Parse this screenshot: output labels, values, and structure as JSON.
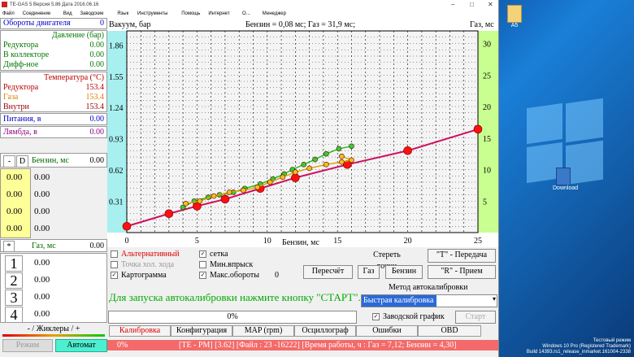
{
  "window": {
    "title": "TE-GAS 5 Версия 5.86  Дата 2016.06.16"
  },
  "menu": [
    "Файл",
    "Соединение",
    "Вид",
    "Заводские",
    "Язык",
    "Инструменты",
    "Помощь",
    "Интернет",
    "О...",
    "Менеджер"
  ],
  "left": {
    "rpm_label": "Обороты двигателя",
    "rpm_value": "0",
    "pressure_header": "Давление (бар)",
    "reducer_label": "Редуктора",
    "reducer_value": "0.00",
    "collector_label": "В коллекторе",
    "collector_value": "0.00",
    "diff_label": "Дифф-ное",
    "diff_value": "0.00",
    "temp_header": "Температура (°C)",
    "t_reducer_label": "Редуктора",
    "t_reducer_value": "153.4",
    "t_gas_label": "Газа",
    "t_gas_value": "153.4",
    "t_inside_label": "Внутри",
    "t_inside_value": "153.4",
    "supply_label": "Питания, в",
    "supply_value": "0.00",
    "lambda_label": "Лямбда, в",
    "lambda_value": "0.00",
    "minus": "-",
    "d": "D",
    "petrol_ms_label": "Бензин, мс",
    "petrol_ms_value": "0.00",
    "grid_values": [
      [
        "0.00",
        "0.00"
      ],
      [
        "0.00",
        "0.00"
      ],
      [
        "0.00",
        "0.00"
      ],
      [
        "0.00",
        "0.00"
      ]
    ],
    "star": "*",
    "gas_ms_label": "Газ, мс",
    "gas_ms_value": "0.00",
    "injectors": [
      {
        "n": "1",
        "v": "0.00"
      },
      {
        "n": "2",
        "v": "0.00"
      },
      {
        "n": "3",
        "v": "0.00"
      },
      {
        "n": "4",
        "v": "0.00"
      }
    ],
    "jiklers": "- / Жиклеры / +",
    "mode_off": "Режим",
    "mode_auto": "Автомат"
  },
  "chart_data": {
    "type": "scatter",
    "header_left": "Вакуум, бар",
    "header_mid": "Бензин = 0,08 мс; Газ = 31,9 мс;",
    "header_right": "Газ, мс",
    "xlabel": "Бензин, мс",
    "xticks": [
      "0",
      "5",
      "10",
      "15",
      "20",
      "25"
    ],
    "xlim": [
      0,
      25
    ],
    "yticks_left": [
      "0.31",
      "0.62",
      "0.93",
      "1.24",
      "1.55",
      "1.86"
    ],
    "ylim_left": [
      0,
      2.0
    ],
    "yticks_right": [
      "5",
      "10",
      "15",
      "20",
      "25",
      "30"
    ],
    "ylim_right": [
      0,
      32
    ],
    "grid": true,
    "series": [
      {
        "color": "#d01060",
        "marker": "#ff1010",
        "x": [
          0,
          3,
          5,
          7,
          9.5,
          12,
          15.7,
          20,
          25
        ],
        "y": [
          1.0,
          3.0,
          4.2,
          5.3,
          7.0,
          8.7,
          10.8,
          13.0,
          16.4
        ]
      },
      {
        "color": "#20c020",
        "marker": "#30d030",
        "x": [
          4,
          4.8,
          5.8,
          6.6,
          7.6,
          8.4,
          9.5,
          10.4,
          11.2,
          11.8,
          12.6,
          13.4,
          14.2,
          15.1,
          16
        ],
        "y": [
          4.0,
          5.0,
          5.6,
          6.0,
          6.4,
          7.0,
          7.7,
          8.5,
          9.3,
          10.0,
          10.8,
          11.6,
          12.5,
          13.3,
          13.7
        ]
      },
      {
        "color": "#e0a000",
        "marker": "#f0c020",
        "x": [
          4.2,
          5.2,
          6.2,
          7.3,
          8.3,
          9.3,
          10.2,
          11.1,
          12.0,
          13.0,
          14.2,
          15.3,
          16.0,
          15.3
        ],
        "y": [
          4.6,
          5.0,
          5.8,
          6.4,
          6.7,
          7.2,
          8.0,
          8.8,
          9.6,
          10.2,
          10.8,
          11.2,
          11.5,
          12.1
        ]
      }
    ]
  },
  "controls": {
    "alt": "Альтернативный",
    "grid": "сетка",
    "clear": "Стереть точки",
    "t_send": "\"T\" - Передача",
    "tochka": "Точка хол. хода",
    "minvpr": "Мин.впрыск",
    "kartogramma": "Картограмма",
    "maxrpm": "Макс.обороты",
    "maxrpm_val": "0",
    "recalc": "Пересчёт",
    "gas": "Газ",
    "petrol": "Бензин",
    "r_recv": "\"R\" - Прием",
    "method": "Метод автокалибровки",
    "start_msg": "Для запуска автокалибровки нажмите кнопку \"СТАРТ\".",
    "fast": "Быстрая калибровка",
    "progress": "0%",
    "factory": "Заводской график",
    "start": "Старт"
  },
  "tabs": [
    "Калибровка",
    "Конфигурация",
    "MAP (rpm)",
    "Осциллограф",
    "Ошибки",
    "OBD"
  ],
  "status": {
    "pct": "0%",
    "text": "[TE - PM] [3.62] [Файл : 23 -16222] [Время работы, ч : Газ = 7,12; Бензин = 4,30]"
  },
  "desktop": {
    "icon1": "A5",
    "icon2": "Download",
    "wm1": "Тестовый режим",
    "wm2": "Windows 10 Pro (Registered Trademark)",
    "wm3": "Build 14393.rs1_release_inmarket.161004-2338"
  }
}
